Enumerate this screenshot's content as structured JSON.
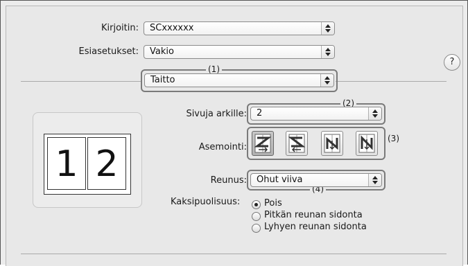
{
  "printer": {
    "label": "Kirjoitin:",
    "value": "SCxxxxxx"
  },
  "presets": {
    "label": "Esiasetukset:",
    "value": "Vakio"
  },
  "panel": {
    "value": "Taitto"
  },
  "help": {
    "label": "?"
  },
  "callouts": {
    "c1": "(1)",
    "c2": "(2)",
    "c3": "(3)",
    "c4": "(4)"
  },
  "preview": {
    "page_left": "1",
    "page_right": "2"
  },
  "pages_per_sheet": {
    "label": "Sivuja arkille:",
    "value": "2"
  },
  "layout_direction": {
    "label": "Asemointi:",
    "options": [
      {
        "icon": "z-left-right-icon",
        "selected": true
      },
      {
        "icon": "z-right-left-icon",
        "selected": false
      },
      {
        "icon": "n-top-bottom-left-icon",
        "selected": false
      },
      {
        "icon": "n-top-bottom-right-icon",
        "selected": false
      }
    ]
  },
  "border": {
    "label": "Reunus:",
    "value": "Ohut viiva"
  },
  "two_sided": {
    "label": "Kaksipuolisuus:",
    "options": [
      {
        "label": "Pois",
        "selected": true
      },
      {
        "label": "Pitkän reunan sidonta",
        "selected": false
      },
      {
        "label": "Lyhyen reunan sidonta",
        "selected": false
      }
    ]
  }
}
